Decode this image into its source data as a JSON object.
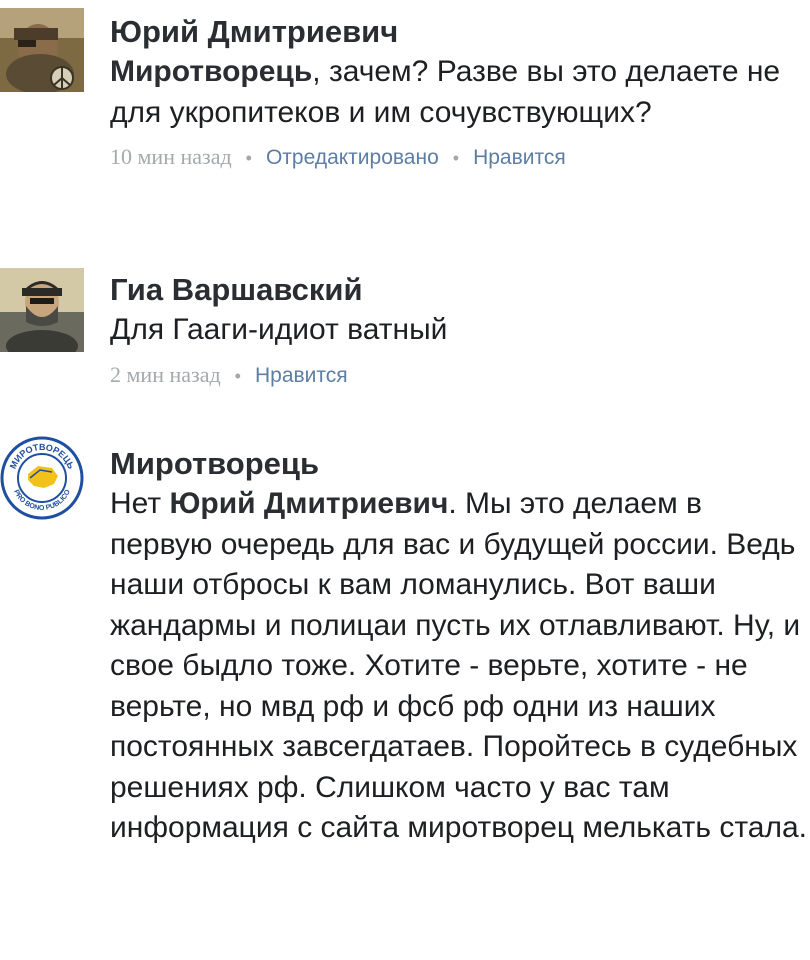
{
  "comments": [
    {
      "author": "Юрий Дмитриевич",
      "mention": "Миротворець",
      "text": ", зачем? Разве вы это делаете не для укропитеков и им сочувствующих?",
      "time": "10 мин назад",
      "edited": "Отредактировано",
      "like": "Нравится"
    },
    {
      "author": "Гиа Варшавский",
      "text": "Для Гааги-идиот ватный",
      "time": "2 мин назад",
      "like": "Нравится"
    },
    {
      "author": "Миротворець",
      "text_prefix": "Нет ",
      "mention": "Юрий Дмитриевич",
      "text": ". Мы это делаем в первую очередь для вас и будущей россии. Ведь наши отбросы к вам ломанулись. Вот ваши жандармы и полицаи пусть их отлавливают. Ну, и свое быдло тоже. Хотите - верьте, хотите - не верьте, но мвд рф и фсб рф одни из наших постоянных завсегдатаев. Поройтесь в судебных решениях рф. Слишком часто у вас там информация с сайта миротворец мелькать стала.",
      "logo_text_top": "МИРОТВОРЕЦЬ",
      "logo_text_bottom": "PRO BONO PUBLICO"
    }
  ],
  "colors": {
    "accent": "#5d7ea4",
    "meta": "#a3a8ae",
    "text": "#1d1f22",
    "logo_blue": "#1f4fa0",
    "logo_yellow": "#f2c21a"
  }
}
